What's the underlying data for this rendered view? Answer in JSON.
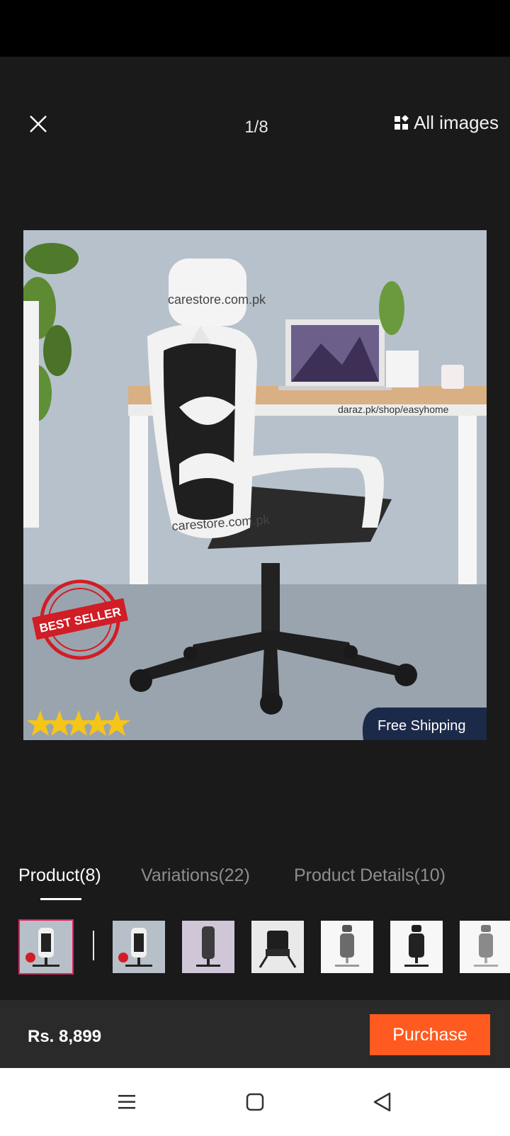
{
  "viewer": {
    "counter": "1/8",
    "all_images_label": "All images",
    "icons": {
      "close": "close-icon",
      "all_images": "grid-icon"
    }
  },
  "main_image": {
    "watermark_top": "carestore.com.pk",
    "watermark_bottom": "carestore.com.pk",
    "shop_url": "daraz.pk/shop/easyhome",
    "seal_text": "BEST SELLER",
    "shipping_badge": "Free Shipping",
    "stars": 5
  },
  "tabs": [
    {
      "label": "Product(8)",
      "active": true
    },
    {
      "label": "Variations(22)",
      "active": false
    },
    {
      "label": "Product Details(10)",
      "active": false
    }
  ],
  "thumbnails": [
    {
      "variant": "white-chair",
      "selected": true
    },
    {
      "variant": "white-chair",
      "selected": false
    },
    {
      "variant": "purple-bg-chair",
      "selected": false
    },
    {
      "variant": "black-task-chair",
      "selected": false
    },
    {
      "variant": "gray-chair",
      "selected": false
    },
    {
      "variant": "black-mesh-chair",
      "selected": false
    },
    {
      "variant": "gray-headrest-chair",
      "selected": false
    }
  ],
  "footer": {
    "price": "Rs. 8,899",
    "purchase_label": "Purchase",
    "colors": {
      "purchase_button": "#ff5a1f",
      "tab_active": "#ffffff",
      "tab_inactive": "#8e8e8e",
      "selected_thumb": "#e0245e"
    }
  },
  "nav": {
    "icons": [
      "menu-icon",
      "home-square-icon",
      "back-triangle-icon"
    ]
  }
}
